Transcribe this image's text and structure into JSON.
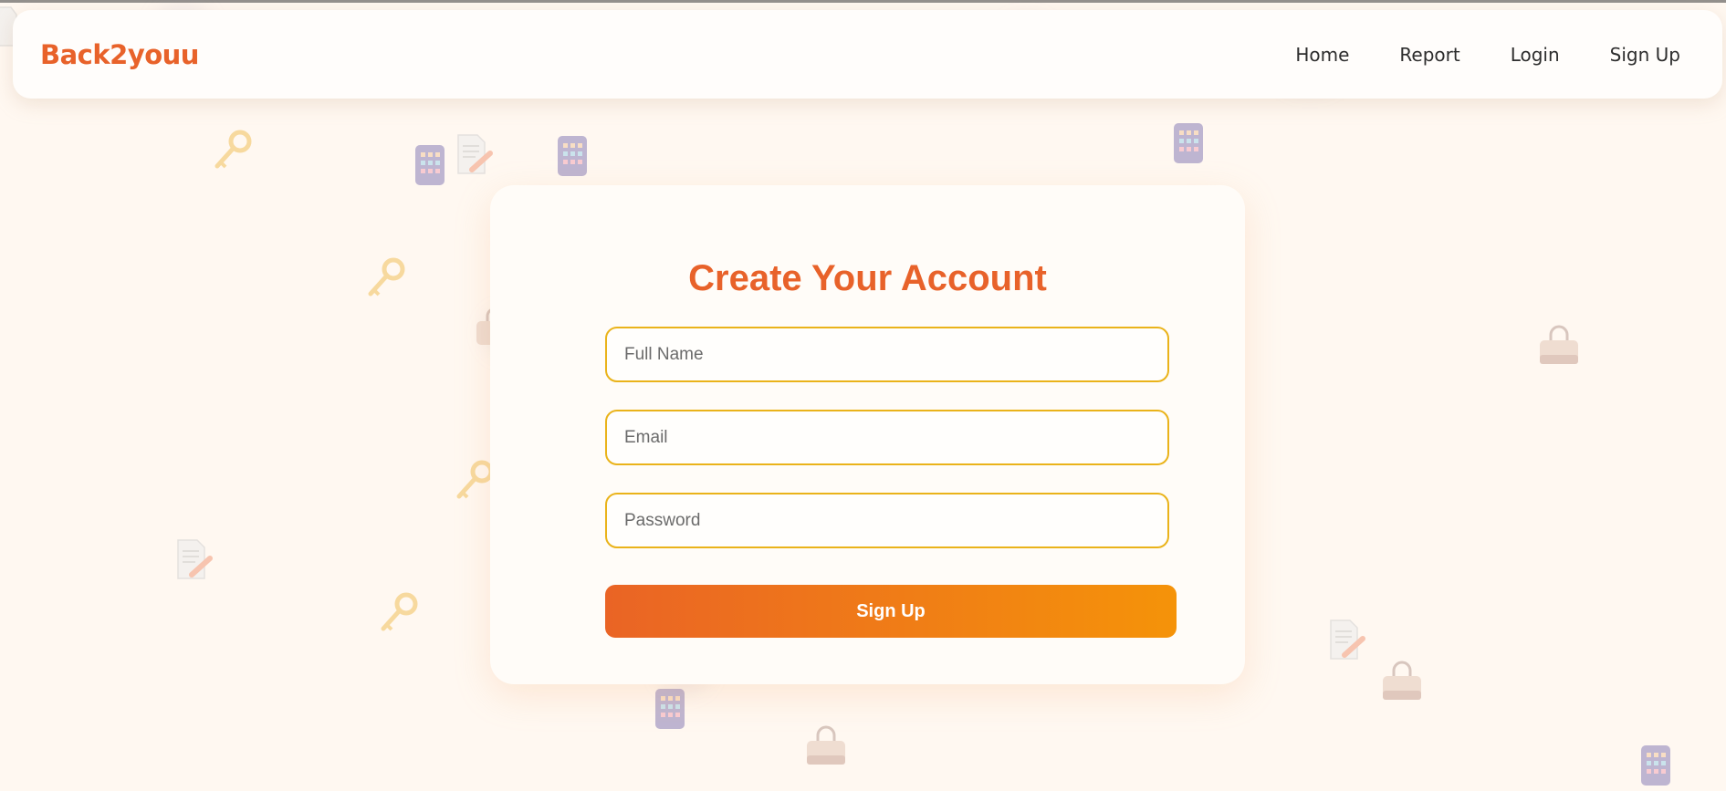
{
  "navbar": {
    "brand": "Back2youu",
    "links": [
      "Home",
      "Report",
      "Login",
      "Sign Up"
    ]
  },
  "form": {
    "title": "Create Your Account",
    "full_name_placeholder": "Full Name",
    "email_placeholder": "Email",
    "password_placeholder": "Password",
    "submit_label": "Sign Up"
  },
  "colors": {
    "brand": "#e8622a",
    "field_border": "#eab31a",
    "button_gradient_start": "#ea6425",
    "button_gradient_end": "#f59309",
    "background": "#fff8f1"
  },
  "icons": {
    "background_decorations": [
      "key-icon",
      "phone-icon",
      "document-icon",
      "bag-icon"
    ]
  }
}
